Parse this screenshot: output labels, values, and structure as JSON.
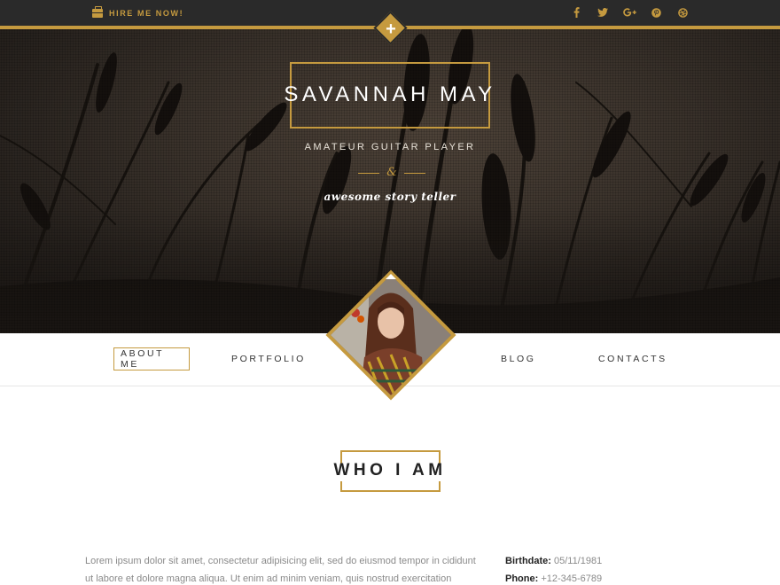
{
  "topbar": {
    "hire_label": "HIRE ME NOW!",
    "social_icons": [
      "facebook-icon",
      "twitter-icon",
      "google-plus-icon",
      "pinterest-icon",
      "dribbble-icon"
    ]
  },
  "hero": {
    "name": "SAVANNAH MAY",
    "subtitle": "AMATEUR GUITAR PLAYER",
    "ampersand": "&",
    "tagline": "awesome story teller"
  },
  "nav": {
    "items": [
      {
        "label": "ABOUT ME",
        "active": true
      },
      {
        "label": "PORTFOLIO",
        "active": false
      },
      {
        "label": "BLOG",
        "active": false
      },
      {
        "label": "CONTACTS",
        "active": false
      }
    ]
  },
  "section": {
    "title": "WHO I AM",
    "intro": "Lorem ipsum dolor sit amet, consectetur adipisicing elit, sed do eiusmod tempor in cididunt ut labore et dolore magna aliqua. Ut enim ad minim veniam, quis nostrud exercitation ullamco",
    "info": {
      "birthdate_label": "Birthdate:",
      "birthdate_value": "05/11/1981",
      "phone_label": "Phone:",
      "phone_value": "+12-345-6789"
    }
  },
  "colors": {
    "accent": "#c59a3f",
    "topbar_bg": "#2a2a2a"
  }
}
